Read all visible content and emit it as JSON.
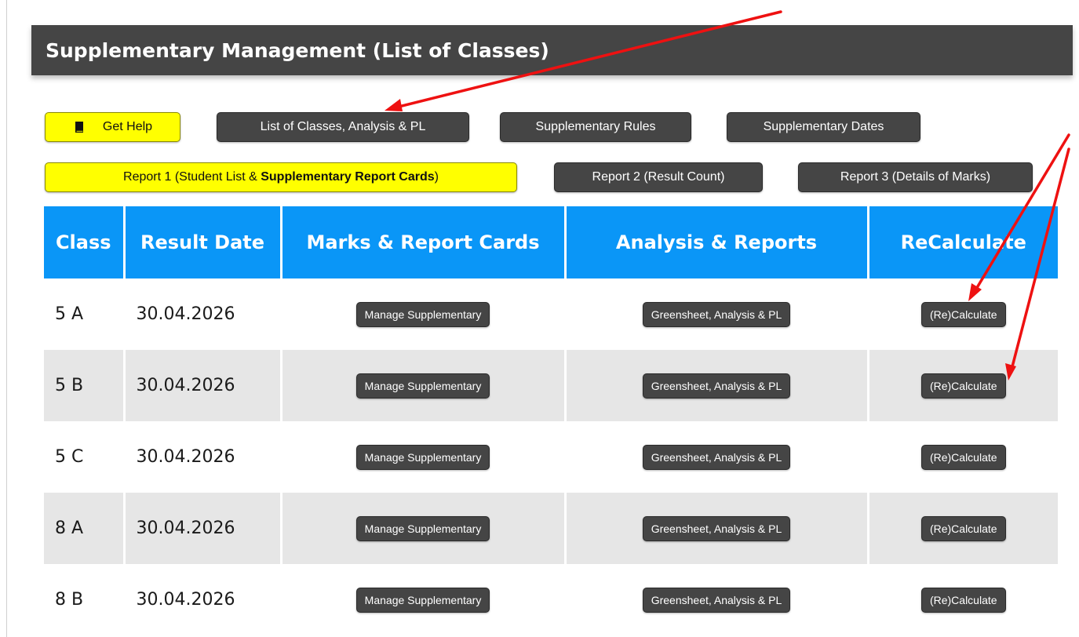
{
  "page": {
    "title": "Supplementary Management (List of Classes)"
  },
  "toolbar": {
    "get_help": "Get Help",
    "list_classes": "List of Classes, Analysis & PL",
    "supp_rules": "Supplementary Rules",
    "supp_dates": "Supplementary Dates",
    "report1_prefix": "Report 1 (Student List & ",
    "report1_bold": "Supplementary Report Cards",
    "report1_suffix": ")",
    "report2": "Report 2 (Result Count)",
    "report3": "Report 3 (Details of Marks)"
  },
  "table": {
    "headers": [
      "Class",
      "Result Date",
      "Marks & Report Cards",
      "Analysis & Reports",
      "ReCalculate"
    ],
    "rows": [
      {
        "class": "5 A",
        "date": "30.04.2026",
        "marks_btn": "Manage Supplementary",
        "analysis_btn": "Greensheet, Analysis & PL",
        "recalc_btn": "(Re)Calculate"
      },
      {
        "class": "5 B",
        "date": "30.04.2026",
        "marks_btn": "Manage Supplementary",
        "analysis_btn": "Greensheet, Analysis & PL",
        "recalc_btn": "(Re)Calculate"
      },
      {
        "class": "5 C",
        "date": "30.04.2026",
        "marks_btn": "Manage Supplementary",
        "analysis_btn": "Greensheet, Analysis & PL",
        "recalc_btn": "(Re)Calculate"
      },
      {
        "class": "8 A",
        "date": "30.04.2026",
        "marks_btn": "Manage Supplementary",
        "analysis_btn": "Greensheet, Analysis & PL",
        "recalc_btn": "(Re)Calculate"
      },
      {
        "class": "8 B",
        "date": "30.04.2026",
        "marks_btn": "Manage Supplementary",
        "analysis_btn": "Greensheet, Analysis & PL",
        "recalc_btn": "(Re)Calculate"
      }
    ]
  },
  "colors": {
    "title_bar": "#454545",
    "button_dark": "#454545",
    "button_yellow": "#ffff00",
    "table_header": "#0a96f7",
    "row_alt": "#e6e6e6",
    "annotation_arrow": "#ee1111"
  },
  "icons": {
    "help": "book-icon"
  }
}
